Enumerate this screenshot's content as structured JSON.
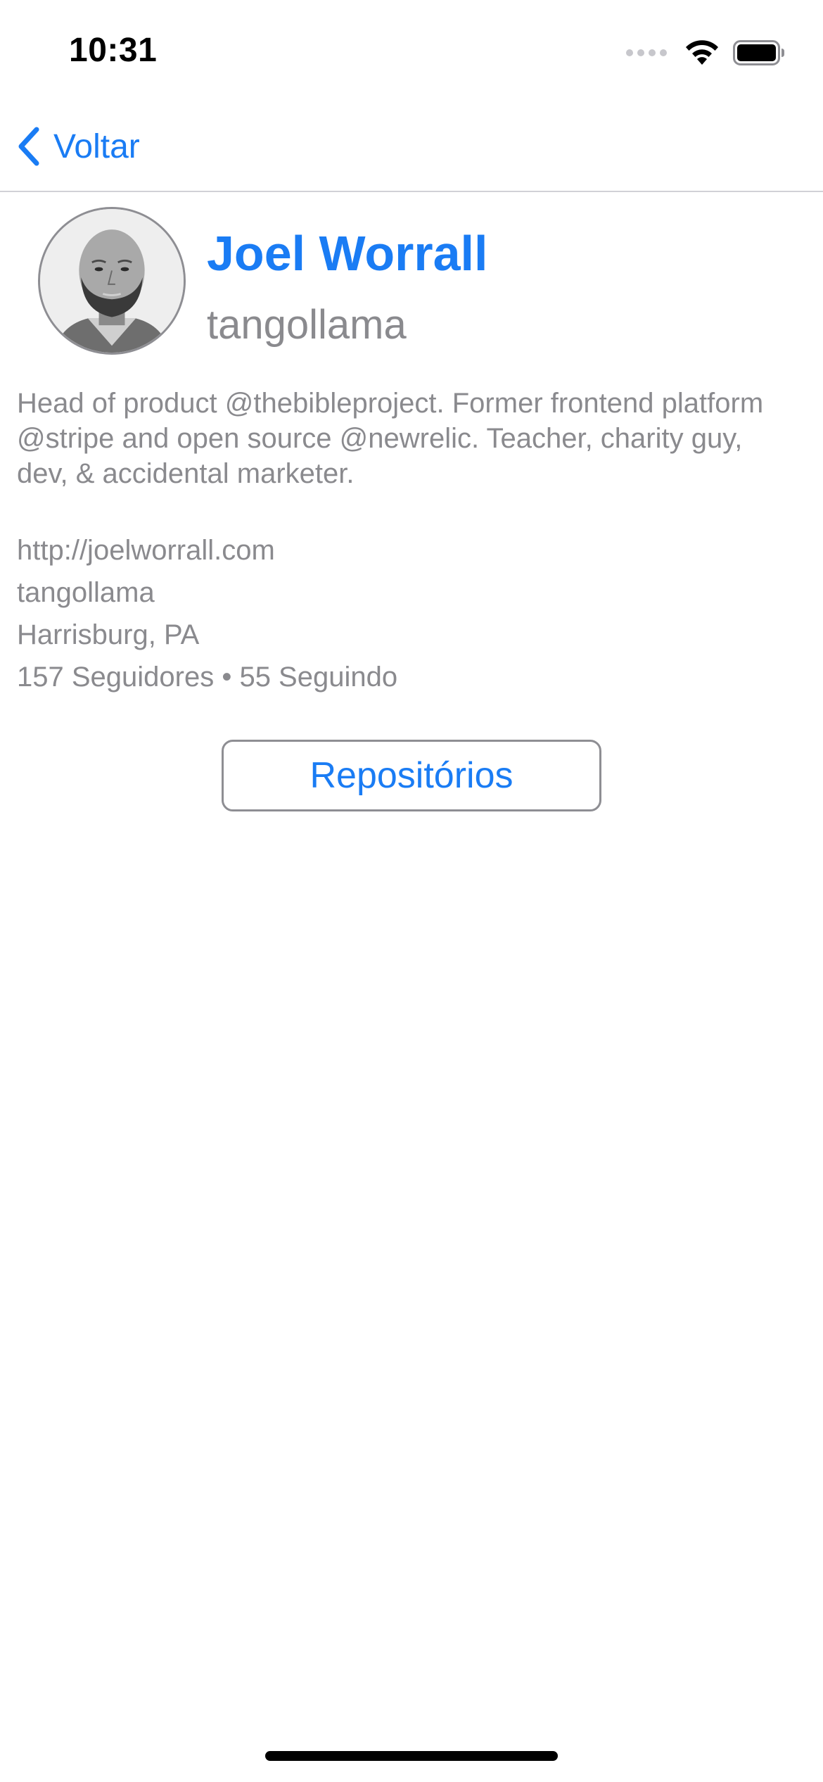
{
  "status_bar": {
    "time": "10:31",
    "icons": [
      "cellular-signal-icon",
      "wifi-icon",
      "battery-icon"
    ]
  },
  "nav": {
    "back_label": "Voltar",
    "back_icon": "chevron-left-icon"
  },
  "profile": {
    "name": "Joel Worrall",
    "login": "tangollama",
    "bio": "Head of product @thebibleproject. Former frontend platform @stripe and open source @newrelic. Teacher, charity guy, dev, & accidental marketer.",
    "blog": "http://joelworrall.com",
    "company": "tangollama",
    "location": "Harrisburg, PA",
    "followers_following": "157 Seguidores • 55 Seguindo"
  },
  "actions": {
    "repositories_label": "Repositórios"
  },
  "colors": {
    "accent": "#1a7cf4",
    "secondary_text": "#8a8a8e",
    "border": "#8e8e93",
    "separator": "#d1d1d6"
  }
}
